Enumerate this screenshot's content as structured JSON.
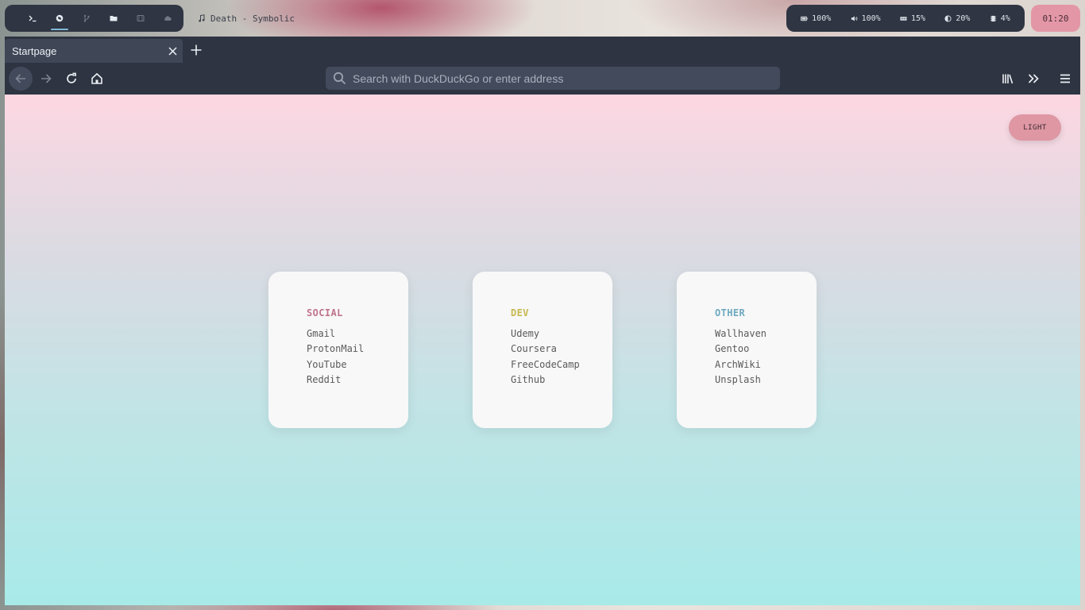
{
  "topbar": {
    "workspaces": [
      {
        "icon": "terminal-icon",
        "active": false
      },
      {
        "icon": "browser-icon",
        "active": true
      },
      {
        "icon": "git-branch-icon",
        "active": false
      },
      {
        "icon": "folder-icon",
        "active": false
      },
      {
        "icon": "film-icon",
        "active": false
      },
      {
        "icon": "cloud-icon",
        "active": false
      }
    ],
    "now_playing": {
      "icon": "music-note-icon",
      "text": "Death - Symbolic"
    },
    "status": {
      "battery": "100%",
      "volume": "100%",
      "memory": "15%",
      "brightness": "20%",
      "cpu": "4%"
    },
    "clock": "01:20"
  },
  "browser": {
    "tab": {
      "title": "Startpage"
    },
    "urlbar": {
      "placeholder": "Search with DuckDuckGo or enter address"
    }
  },
  "startpage": {
    "theme_button": "LIGHT",
    "cards": [
      {
        "title": "SOCIAL",
        "color": "#c0748b",
        "links": [
          "Gmail",
          "ProtonMail",
          "YouTube",
          "Reddit"
        ]
      },
      {
        "title": "DEV",
        "color": "#c6b84f",
        "links": [
          "Udemy",
          "Coursera",
          "FreeCodeCamp",
          "Github"
        ]
      },
      {
        "title": "OTHER",
        "color": "#6ea9c0",
        "links": [
          "Wallhaven",
          "Gentoo",
          "ArchWiki",
          "Unsplash"
        ]
      }
    ]
  },
  "colors": {
    "bar_bg": "#2f3542",
    "accent_pink": "#e397a6",
    "accent_blue": "#7fb8d6"
  }
}
